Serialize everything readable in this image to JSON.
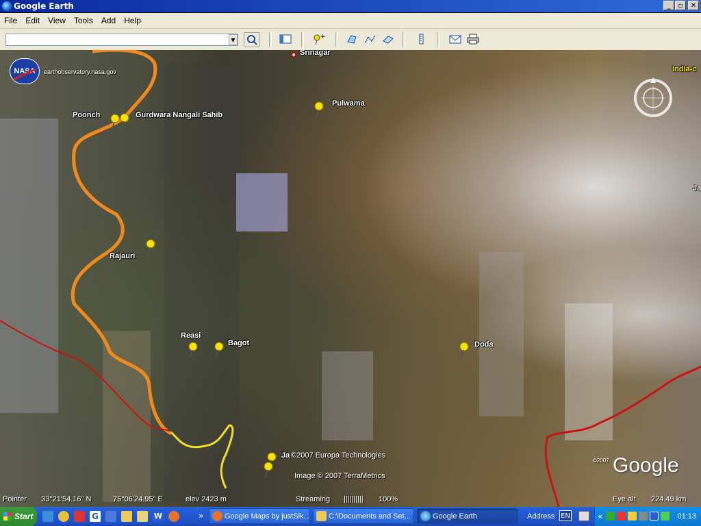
{
  "window": {
    "title": "Google Earth"
  },
  "menu": [
    "File",
    "Edit",
    "View",
    "Tools",
    "Add",
    "Help"
  ],
  "toolbar": {
    "search_value": "",
    "search_placeholder": "",
    "icons": [
      "sidebar-toggle-icon",
      "placemark-icon",
      "polygon-icon",
      "path-icon",
      "image-overlay-icon",
      "ruler-icon",
      "email-icon",
      "print-icon"
    ]
  },
  "map": {
    "attribution": "earthobservatory.nasa.gov",
    "nasa_logo": "NASA",
    "places": [
      {
        "name": "Srinagar"
      },
      {
        "name": "Pulwama"
      },
      {
        "name": "Poonch"
      },
      {
        "name": "Gurdwara Nangali Sahib"
      },
      {
        "name": "Rajauri"
      },
      {
        "name": "Reasi"
      },
      {
        "name": "Bagot"
      },
      {
        "name": "Doda"
      },
      {
        "name": "Ja"
      },
      {
        "name": "India-c"
      },
      {
        "name": "Ja"
      }
    ],
    "copyright1": "©2007 Europa Technologies",
    "copyright2": "Image © 2007 TerraMetrics",
    "google_year": "©2007",
    "google_logo": "Google"
  },
  "statusbar": {
    "pointer_label": "Pointer",
    "lat": "33°21'54.16\" N",
    "lon": "75°06'24.95\" E",
    "elev": "elev 2423 m",
    "streaming_label": "Streaming",
    "streaming_bars": "||||||||||",
    "streaming_percent": "100%",
    "eye_alt_label": "Eye alt",
    "eye_alt_value": "224.49 km"
  },
  "taskbar": {
    "start": "Start",
    "windows": [
      {
        "label": "Google Maps by justSik..."
      },
      {
        "label": "C:\\Documents and Set..."
      },
      {
        "label": "Google Earth"
      }
    ],
    "address_label": "Address",
    "lang": "EN",
    "clock": "01:13",
    "chevron": "»",
    "tray_chevron": "«"
  },
  "colors": {
    "border_orange": "#f08a1c",
    "border_red": "#cc1111",
    "border_yellow": "#f0e020",
    "pin_yellow": "#f5e400"
  }
}
